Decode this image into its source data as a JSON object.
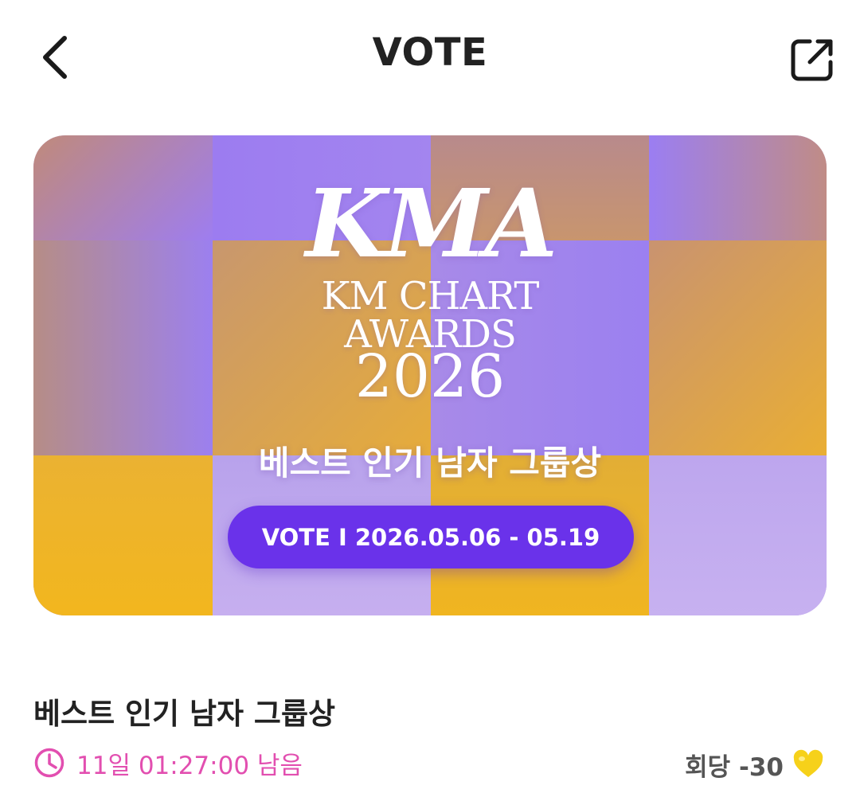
{
  "header": {
    "title": "VOTE",
    "back_icon": "chevron-left-icon",
    "share_icon": "share-external-icon"
  },
  "banner": {
    "logo": "KMA",
    "line1": "KM CHART",
    "line2": "AWARDS",
    "year": "2026",
    "award": "베스트 인기 남자 그룹상",
    "vote_period": "VOTE I 2026.05.06 - 05.19",
    "colors": {
      "purple": "#a688f0",
      "yellow": "#f2b61e",
      "lavender": "#b9a4ec",
      "pill": "#6a32ea"
    }
  },
  "info": {
    "award_title": "베스트 인기 남자 그룹상",
    "time_remaining": "11일 01:27:00 남음",
    "cost_label": "회당 -30",
    "timer_color": "#e24fb0",
    "clock_icon": "clock-icon",
    "heart_icon": "yellow-heart-icon"
  }
}
